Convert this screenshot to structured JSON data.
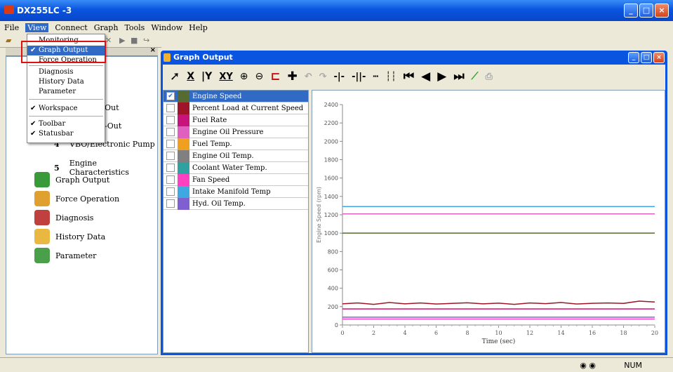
{
  "app": {
    "title": "DX255LC -3"
  },
  "menu": [
    "File",
    "View",
    "Connect",
    "Graph",
    "Tools",
    "Window",
    "Help"
  ],
  "view_menu": [
    {
      "label": "Monitoring",
      "checked": false
    },
    {
      "label": "Graph Output",
      "checked": true
    },
    {
      "label": "Force Operation",
      "checked": false
    },
    {
      "label": "Diagnosis",
      "checked": false
    },
    {
      "label": "History Data",
      "checked": false
    },
    {
      "label": "Parameter",
      "checked": false
    },
    {
      "label": "Workspace",
      "checked": true
    },
    {
      "label": "Toolbar",
      "checked": true
    },
    {
      "label": "Statusbar",
      "checked": true
    }
  ],
  "workspace": {
    "partial_items": [
      "Out",
      "-Out"
    ],
    "numbered": [
      {
        "num": "4",
        "label": "VBO/Electronic Pump"
      },
      {
        "num": "5",
        "label": "Engine Characteristics"
      }
    ],
    "items": [
      {
        "label": "Graph Output",
        "icon": "graph-output-icon",
        "color": "#3a9a3a"
      },
      {
        "label": "Force Operation",
        "icon": "force-operation-icon",
        "color": "#e0a030"
      },
      {
        "label": "Diagnosis",
        "icon": "diagnosis-icon",
        "color": "#c04040"
      },
      {
        "label": "History Data",
        "icon": "history-data-icon",
        "color": "#e8b840"
      },
      {
        "label": "Parameter",
        "icon": "parameter-icon",
        "color": "#4aa04a"
      }
    ]
  },
  "graph_window": {
    "title": "Graph Output"
  },
  "toolbar_icons": [
    "select-arrow-icon",
    "x-zoom-icon",
    "y-zoom-icon",
    "xy-zoom-icon",
    "zoom-in-icon",
    "zoom-out-icon",
    "range-icon",
    "pan-icon",
    "undo-icon",
    "redo-icon",
    "cursor-left-icon",
    "cursor-right-icon",
    "horizontal-line-icon",
    "vertical-line-icon",
    "first-icon",
    "prev-icon",
    "play-icon",
    "last-icon",
    "auto-scale-icon",
    "print-icon"
  ],
  "series": [
    {
      "label": "Engine Speed",
      "color": "#556b2f",
      "checked": true
    },
    {
      "label": "Percent Load at Current Speed",
      "color": "#a0142a",
      "checked": false
    },
    {
      "label": "Fuel Rate",
      "color": "#c8147a",
      "checked": false
    },
    {
      "label": "Engine Oil Pressure",
      "color": "#e060c0",
      "checked": false
    },
    {
      "label": "Fuel Temp.",
      "color": "#f0a020",
      "checked": false
    },
    {
      "label": "Engine Oil Temp.",
      "color": "#808080",
      "checked": false
    },
    {
      "label": "Coolant Water Temp.",
      "color": "#30a0a0",
      "checked": false
    },
    {
      "label": "Fan Speed",
      "color": "#ff40c0",
      "checked": false
    },
    {
      "label": "Intake Manifold Temp",
      "color": "#40a8e0",
      "checked": false
    },
    {
      "label": "Hyd. Oil Temp.",
      "color": "#8060d0",
      "checked": false
    }
  ],
  "chart_data": {
    "type": "line",
    "xlabel": "Time (sec)",
    "ylabel": "Engine Speed (rpm)",
    "xlim": [
      0,
      20
    ],
    "ylim": [
      0,
      2400
    ],
    "xticks": [
      0,
      2,
      4,
      6,
      8,
      10,
      12,
      14,
      16,
      18,
      20
    ],
    "yticks": [
      0,
      200,
      400,
      600,
      800,
      1000,
      1200,
      1400,
      1600,
      1800,
      2000,
      2200,
      2400
    ],
    "series": [
      {
        "color": "#40a8e0",
        "x": [
          0,
          20
        ],
        "y": [
          1290,
          1290
        ]
      },
      {
        "color": "#e060c0",
        "x": [
          0,
          20
        ],
        "y": [
          1210,
          1210
        ]
      },
      {
        "color": "#556b2f",
        "x": [
          0,
          20
        ],
        "y": [
          1000,
          1000
        ]
      },
      {
        "color": "#a0142a",
        "x": [
          0,
          1,
          2,
          3,
          4,
          5,
          6,
          7,
          8,
          9,
          10,
          11,
          12,
          13,
          14,
          15,
          16,
          17,
          18,
          19,
          20
        ],
        "y": [
          230,
          240,
          225,
          245,
          230,
          240,
          228,
          235,
          242,
          230,
          238,
          225,
          240,
          232,
          245,
          228,
          236,
          240,
          235,
          260,
          250
        ]
      },
      {
        "color": "#c8147a",
        "x": [
          0,
          20
        ],
        "y": [
          175,
          175
        ]
      },
      {
        "color": "#8060d0",
        "x": [
          0,
          20
        ],
        "y": [
          85,
          85
        ]
      },
      {
        "color": "#ff40c0",
        "x": [
          0,
          20
        ],
        "y": [
          65,
          65
        ]
      }
    ]
  },
  "statusbar": {
    "num": "NUM"
  }
}
